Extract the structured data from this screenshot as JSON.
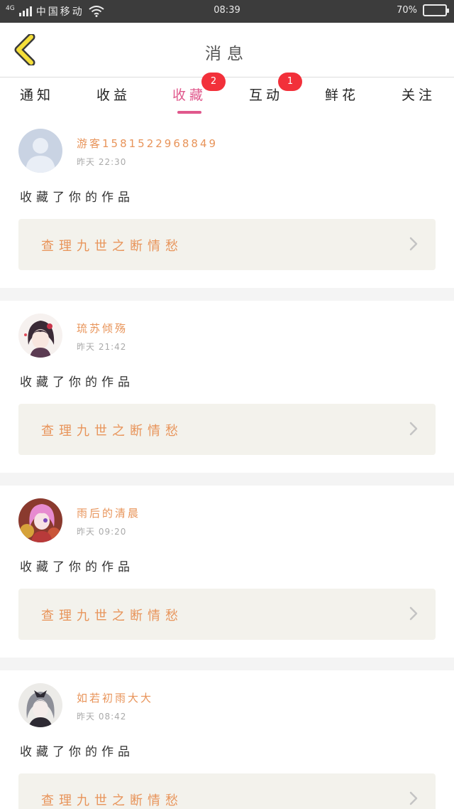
{
  "status_bar": {
    "network": "4G",
    "carrier": "中国移动",
    "time": "08:39",
    "battery": "70%",
    "battery_level": 0.7
  },
  "header": {
    "title": "消息",
    "back_icon": "chevron-left-icon",
    "accent": "#f5df3a"
  },
  "tabs": [
    {
      "label": "通知",
      "badge": "",
      "active": false
    },
    {
      "label": "收益",
      "badge": "",
      "active": false
    },
    {
      "label": "收藏",
      "badge": "2",
      "active": true
    },
    {
      "label": "互动",
      "badge": "1",
      "active": false
    },
    {
      "label": "鲜花",
      "badge": "",
      "active": false
    },
    {
      "label": "关注",
      "badge": "",
      "active": false
    }
  ],
  "colors": {
    "active_tab": "#e0588c",
    "badge": "#f2303a",
    "username": "#e8945a",
    "work_title": "#e8945a",
    "work_bg": "#f3f2ec"
  },
  "feed": [
    {
      "username": "游客15815229688​49",
      "time": "昨天 22:30",
      "action": "收藏了你的作品",
      "work_title": "查理九世之断情愁",
      "avatar": "default-avatar"
    },
    {
      "username": "琉苏倾殇",
      "time": "昨天 21:42",
      "action": "收藏了你的作品",
      "work_title": "查理九世之断情愁",
      "avatar": "anime-avatar-dark-hair"
    },
    {
      "username": "雨后的清晨",
      "time": "昨天 09:20",
      "action": "收藏了你的作品",
      "work_title": "查理九世之断情愁",
      "avatar": "anime-avatar-pink-hair"
    },
    {
      "username": "如若初雨大大",
      "time": "昨天 08:42",
      "action": "收藏了你的作品",
      "work_title": "查理九世之断情愁",
      "avatar": "anime-avatar-grey-hair"
    }
  ]
}
